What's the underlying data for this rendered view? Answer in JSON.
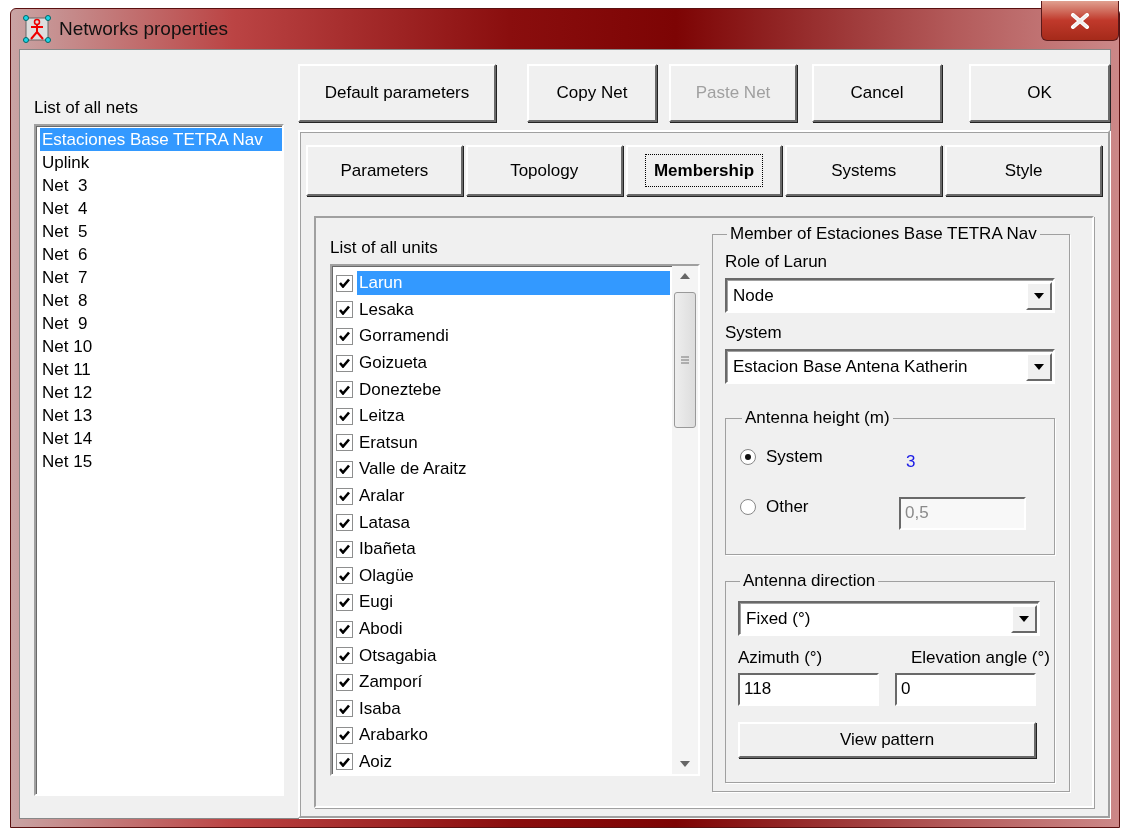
{
  "window": {
    "title": "Networks properties"
  },
  "nets": {
    "label": "List of all nets",
    "items": [
      {
        "label": "Estaciones Base TETRA Nav",
        "selected": true
      },
      {
        "label": "Uplink",
        "selected": false
      },
      {
        "label": "Net  3",
        "selected": false
      },
      {
        "label": "Net  4",
        "selected": false
      },
      {
        "label": "Net  5",
        "selected": false
      },
      {
        "label": "Net  6",
        "selected": false
      },
      {
        "label": "Net  7",
        "selected": false
      },
      {
        "label": "Net  8",
        "selected": false
      },
      {
        "label": "Net  9",
        "selected": false
      },
      {
        "label": "Net 10",
        "selected": false
      },
      {
        "label": "Net 11",
        "selected": false
      },
      {
        "label": "Net 12",
        "selected": false
      },
      {
        "label": "Net 13",
        "selected": false
      },
      {
        "label": "Net 14",
        "selected": false
      },
      {
        "label": "Net 15",
        "selected": false
      }
    ]
  },
  "buttons": [
    {
      "label": "Default parameters",
      "disabled": false
    },
    {
      "label": "Copy Net",
      "disabled": false
    },
    {
      "label": "Paste Net",
      "disabled": true
    },
    {
      "label": "Cancel",
      "disabled": false
    },
    {
      "label": "OK",
      "disabled": false
    }
  ],
  "tabs": [
    {
      "label": "Parameters",
      "selected": false
    },
    {
      "label": "Topology",
      "selected": false
    },
    {
      "label": "Membership",
      "selected": true
    },
    {
      "label": "Systems",
      "selected": false
    },
    {
      "label": "Style",
      "selected": false
    }
  ],
  "units": {
    "label": "List of all units",
    "items": [
      {
        "label": "Larun",
        "checked": true,
        "selected": true
      },
      {
        "label": "Lesaka",
        "checked": true,
        "selected": false
      },
      {
        "label": "Gorramendi",
        "checked": true,
        "selected": false
      },
      {
        "label": "Goizueta",
        "checked": true,
        "selected": false
      },
      {
        "label": "Doneztebe",
        "checked": true,
        "selected": false
      },
      {
        "label": "Leitza",
        "checked": true,
        "selected": false
      },
      {
        "label": "Eratsun",
        "checked": true,
        "selected": false
      },
      {
        "label": "Valle de Araitz",
        "checked": true,
        "selected": false
      },
      {
        "label": "Aralar",
        "checked": true,
        "selected": false
      },
      {
        "label": "Latasa",
        "checked": true,
        "selected": false
      },
      {
        "label": "Ibañeta",
        "checked": true,
        "selected": false
      },
      {
        "label": "Olagüe",
        "checked": true,
        "selected": false
      },
      {
        "label": "Eugi",
        "checked": true,
        "selected": false
      },
      {
        "label": "Abodi",
        "checked": true,
        "selected": false
      },
      {
        "label": "Otsagabia",
        "checked": true,
        "selected": false
      },
      {
        "label": "Zamporí",
        "checked": true,
        "selected": false
      },
      {
        "label": "Isaba",
        "checked": true,
        "selected": false
      },
      {
        "label": "Arabarko",
        "checked": true,
        "selected": false
      },
      {
        "label": "Aoiz",
        "checked": true,
        "selected": false
      }
    ]
  },
  "member": {
    "title": "Member of Estaciones Base TETRA Nav",
    "role_label": "Role of Larun",
    "role_value": "Node",
    "system_label": "System",
    "system_value": "Estacion Base Antena Katherin",
    "height": {
      "title": "Antenna height (m)",
      "options": [
        {
          "label": "System",
          "selected": true
        },
        {
          "label": "Other",
          "selected": false
        }
      ],
      "system_value": "3",
      "other_value": "0,5",
      "other_disabled": true
    },
    "direction": {
      "title": "Antenna direction",
      "mode": "Fixed (°)",
      "azimuth_label": "Azimuth (°)",
      "azimuth_value": "118",
      "elevation_label": "Elevation angle (°)",
      "elevation_value": "0",
      "button": "View pattern"
    }
  }
}
